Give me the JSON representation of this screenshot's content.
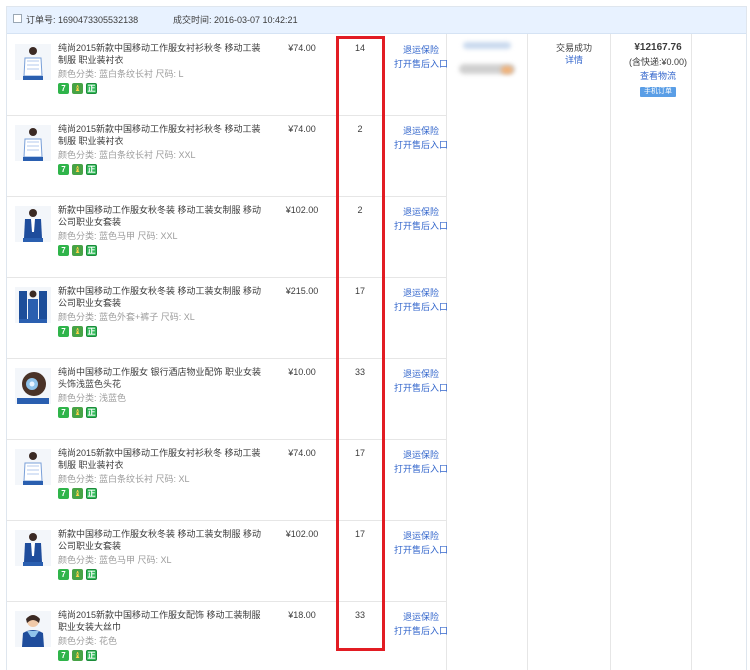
{
  "header": {
    "order_label": "订单号: 1690473305532138",
    "time_label": "成交时间: 2016-03-07 10:42:21"
  },
  "service": {
    "refund_label": "退运保险",
    "aftersale_label": "打开售后入口"
  },
  "status": {
    "text": "交易成功",
    "details_link": "详情"
  },
  "totals": {
    "amount": "¥12167.76",
    "shipping": "(含快递:¥0.00)",
    "logistics_link": "查看物流",
    "mobile_badge": "手机订单"
  },
  "badge_icons": [
    "seven-day-return-icon",
    "guarantee-shield-icon",
    "authentic-icon"
  ],
  "badge_glyphs": {
    "seven": "7",
    "authentic": "正"
  },
  "colors": {
    "highlight_border": "#e21c23",
    "link": "#3366cc",
    "header_bg": "#e8f2ff"
  },
  "items": [
    {
      "title": "纯尚2015新款中国移动工作服女衬衫秋冬 移动工装制服 职业装衬衣",
      "sku": "颜色分类: 蓝白条纹长衬  尺码: L",
      "price": "¥74.00",
      "qty": "14",
      "thumb": "shirt"
    },
    {
      "title": "纯尚2015新款中国移动工作服女衬衫秋冬 移动工装制服 职业装衬衣",
      "sku": "颜色分类: 蓝白条纹长衬  尺码: XXL",
      "price": "¥74.00",
      "qty": "2",
      "thumb": "shirt"
    },
    {
      "title": "新款中国移动工作服女秋冬装 移动工装女制服 移动公司职业女套装",
      "sku": "颜色分类: 蓝色马甲  尺码: XXL",
      "price": "¥102.00",
      "qty": "2",
      "thumb": "vest"
    },
    {
      "title": "新款中国移动工作服女秋冬装 移动工装女制服 移动公司职业女套装",
      "sku": "颜色分类: 蓝色外套+裤子  尺码: XL",
      "price": "¥215.00",
      "qty": "17",
      "thumb": "suit"
    },
    {
      "title": "纯尚中国移动工作服女 银行酒店物业配饰 职业女装头饰浅蓝色头花",
      "sku": "颜色分类: 浅蓝色",
      "price": "¥10.00",
      "qty": "33",
      "thumb": "headflower"
    },
    {
      "title": "纯尚2015新款中国移动工作服女衬衫秋冬 移动工装制服 职业装衬衣",
      "sku": "颜色分类: 蓝白条纹长衬  尺码: XL",
      "price": "¥74.00",
      "qty": "17",
      "thumb": "shirt"
    },
    {
      "title": "新款中国移动工作服女秋冬装 移动工装女制服 移动公司职业女套装",
      "sku": "颜色分类: 蓝色马甲  尺码: XL",
      "price": "¥102.00",
      "qty": "17",
      "thumb": "vest"
    },
    {
      "title": "纯尚2015新款中国移动工作服女配饰 移动工装制服职业女装大丝巾",
      "sku": "颜色分类: 花色",
      "price": "¥18.00",
      "qty": "33",
      "thumb": "scarf"
    }
  ]
}
